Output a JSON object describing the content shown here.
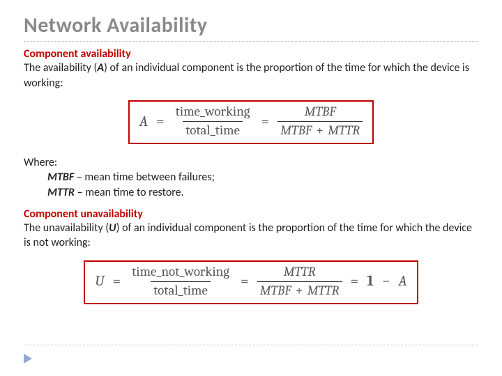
{
  "title": "Network Availability",
  "section1": {
    "heading": "Component availability",
    "text_a": "The availability (",
    "text_b": ") of an individual component is the proportion of the time for which the device is working:",
    "var": "A"
  },
  "formula1": {
    "lhs": "A",
    "eq": "=",
    "f1_num": "time_working",
    "f1_den": "total_time",
    "eq2": "=",
    "f2_num": "MTBF",
    "f2_den_a": "MTBF",
    "f2_den_plus": "+",
    "f2_den_b": "MTTR"
  },
  "where": {
    "label": "Where:",
    "mtbf_term": "MTBF",
    "mtbf_def": " – mean time between failures;",
    "mttr_term": "MTTR",
    "mttr_def": " – mean time to restore."
  },
  "section2": {
    "heading": "Component unavailability",
    "text_a": "The unavailability (",
    "text_b": ") of an individual component is the proportion of the time for which the device is not working:",
    "var": "U"
  },
  "formula2": {
    "lhs": "U",
    "eq": "=",
    "f1_num": "time_not_working",
    "f1_den": "total_time",
    "eq2": "=",
    "f2_num": "MTTR",
    "f2_den_a": "MTBF",
    "f2_den_plus": "+",
    "f2_den_b": "MTTR",
    "eq3": "=",
    "tail_one": "1",
    "tail_minus": "−",
    "tail_A": "A"
  }
}
